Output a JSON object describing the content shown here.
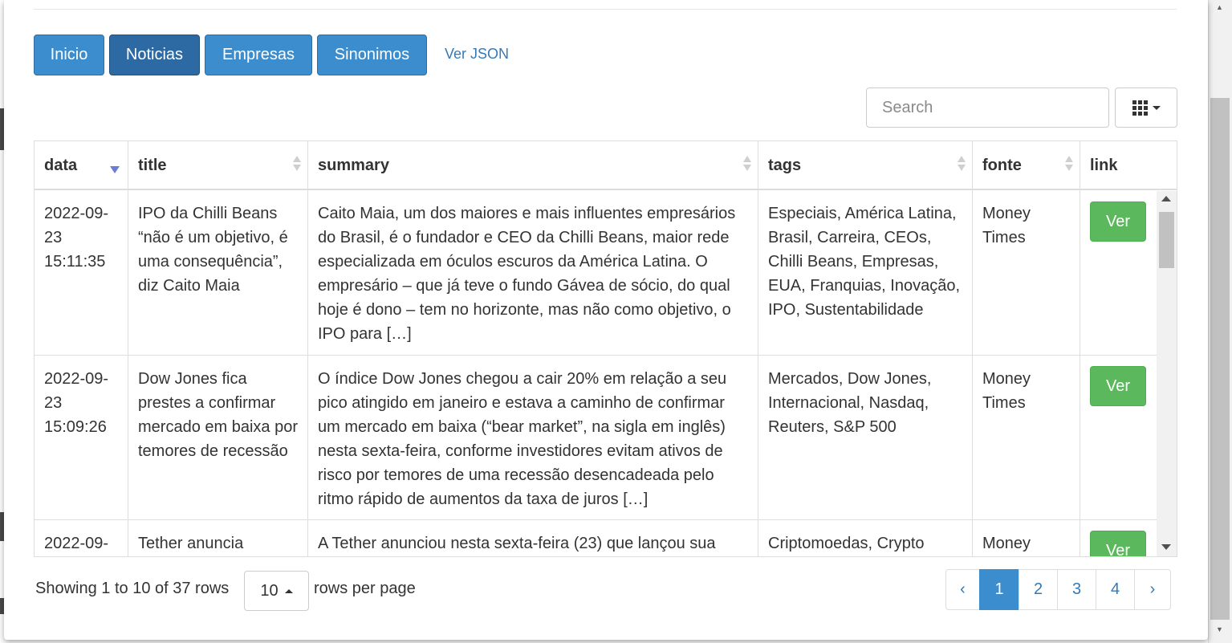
{
  "nav": {
    "inicio": "Inicio",
    "noticias": "Noticias",
    "empresas": "Empresas",
    "sinonimos": "Sinonimos",
    "ver_json": "Ver JSON"
  },
  "toolbar": {
    "search_placeholder": "Search",
    "columns_icon": "grid-icon"
  },
  "table": {
    "headers": [
      "data",
      "title",
      "summary",
      "tags",
      "fonte",
      "link"
    ],
    "sorted_column": "data",
    "sort_direction": "desc",
    "rows": [
      {
        "data": "2022-09-23 15:11:35",
        "title": "IPO da Chilli Beans “não é um objetivo, é uma consequência”, diz Caito Maia",
        "summary": "Caito Maia, um dos maiores e mais influentes empresários do Brasil, é o fundador e CEO da Chilli Beans, maior rede especializada em óculos escuros da América Latina. O empresário – que já teve o fundo Gávea de sócio, do qual hoje é dono – tem no horizonte, mas não como objetivo, o IPO para […]",
        "tags": "Especiais, América Latina, Brasil, Carreira, CEOs, Chilli Beans, Empresas, EUA, Franquias, Inovação, IPO, Sustentabilidade",
        "fonte": "Money Times",
        "link": "Ver"
      },
      {
        "data": "2022-09-23 15:09:26",
        "title": "Dow Jones fica prestes a confirmar mercado em baixa por temores de recessão",
        "summary": "O índice Dow Jones chegou a cair 20% em relação a seu pico atingido em janeiro e estava a caminho de confirmar um mercado em baixa (“bear market”, na sigla em inglês) nesta sexta-feira, conforme investidores evitam ativos de risco por temores de uma recessão desencadeada pelo ritmo rápido de aumentos da taxa de juros […]",
        "tags": "Mercados, Dow Jones, Internacional, Nasdaq, Reuters, S&P 500",
        "fonte": "Money Times",
        "link": "Ver"
      },
      {
        "data": "2022-09-",
        "title": "Tether anuncia",
        "summary": "A Tether anunciou nesta sexta-feira (23) que lançou sua",
        "tags": "Criptomoedas, Crypto",
        "fonte": "Money",
        "link": "Ver"
      }
    ]
  },
  "footer": {
    "showing": "Showing 1 to 10 of 37 rows",
    "page_size": "10",
    "rows_per_page": "rows per page",
    "pages": [
      "‹",
      "1",
      "2",
      "3",
      "4",
      "›"
    ],
    "current_page": "1"
  }
}
